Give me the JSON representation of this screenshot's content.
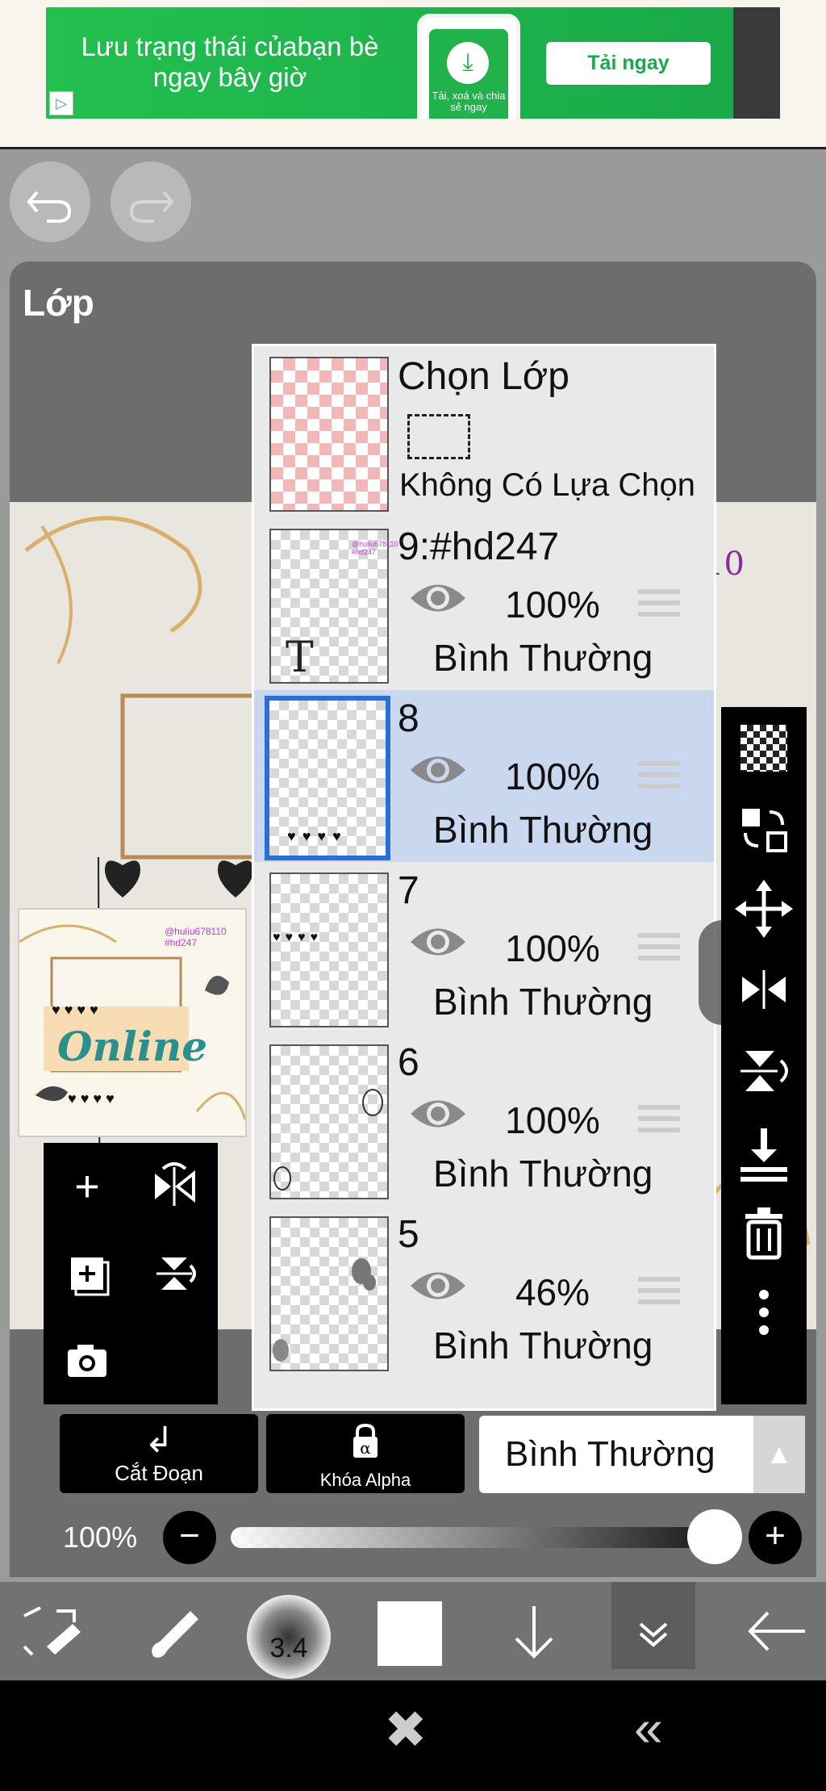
{
  "ad": {
    "headline": "Lưu trạng thái củabạn bè ngay bây giờ",
    "phone_caption": "Tải, xoá và chia sẻ ngay",
    "cta": "Tải ngay"
  },
  "panel": {
    "title": "Lớp"
  },
  "selection_row": {
    "title": "Chọn Lớp",
    "status": "Không Có Lựa Chọn"
  },
  "layers": [
    {
      "name": "9:#hd247",
      "opacity": "100%",
      "blend": "Bình Thường",
      "type_glyph": "T"
    },
    {
      "name": "8",
      "opacity": "100%",
      "blend": "Bình Thường",
      "selected": true
    },
    {
      "name": "7",
      "opacity": "100%",
      "blend": "Bình Thường"
    },
    {
      "name": "6",
      "opacity": "100%",
      "blend": "Bình Thường"
    },
    {
      "name": "5",
      "opacity": "46%",
      "blend": "Bình Thường"
    }
  ],
  "preview": {
    "word": "Online",
    "tag": "@huliu678110 #hd247"
  },
  "controls": {
    "clip_label": "Cắt Đoạn",
    "alpha_lock_label": "Khóa Alpha",
    "blend_mode": "Bình Thường",
    "opacity_label": "100%",
    "opacity_value": 1.0
  },
  "bottom_toolbar": {
    "brush_size": "3.4"
  },
  "colors": {
    "selected_row": "#c9d8ee",
    "selected_border": "#2a6fd8",
    "ad_green": "#22c04f"
  }
}
